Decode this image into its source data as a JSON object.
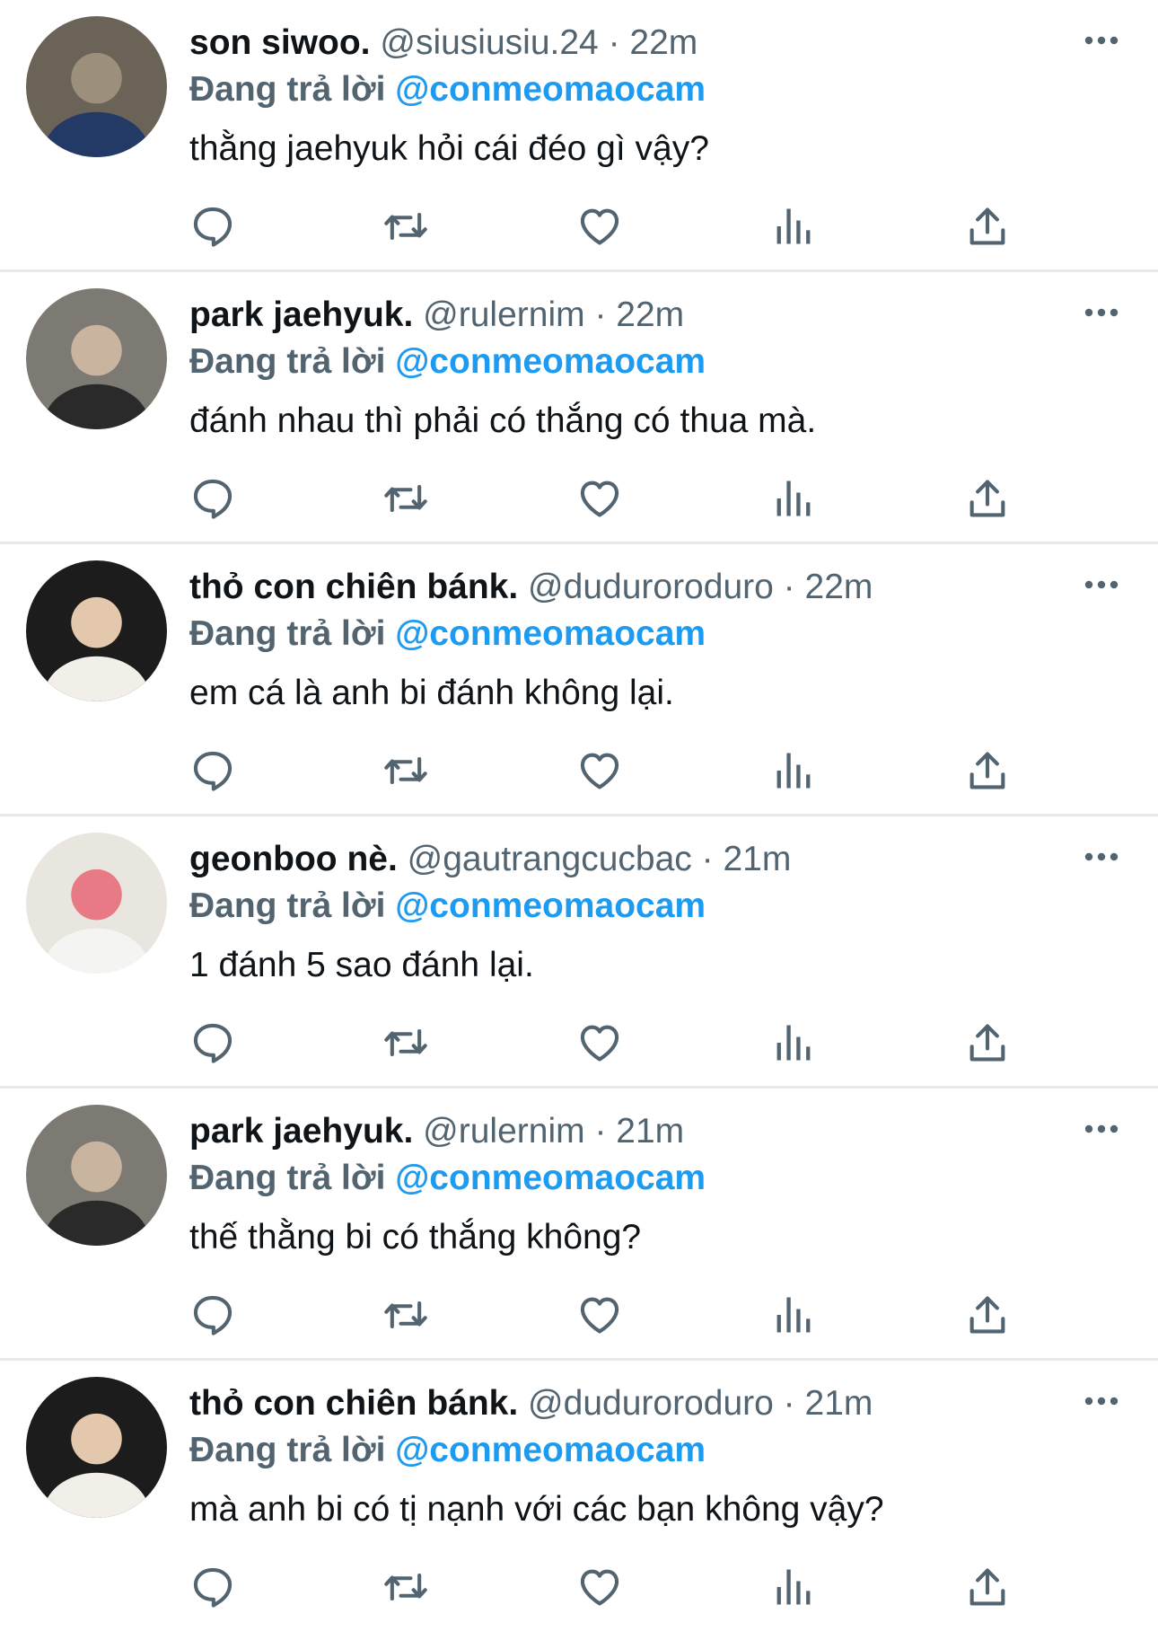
{
  "reply_prefix": "Đang trả lời",
  "tweets": [
    {
      "name": "son siwoo.",
      "handle": "@siusiusiu.24",
      "separator": "·",
      "time": "22m",
      "reply_to": "@conmeomaocam",
      "text": "thằng jaehyuk hỏi cái đéo gì vậy?",
      "avatar_colors": [
        "#6b6357",
        "#233a66",
        "#9c8f7c"
      ]
    },
    {
      "name": "park jaehyuk.",
      "handle": "@rulernim",
      "separator": "·",
      "time": "22m",
      "reply_to": "@conmeomaocam",
      "text": "đánh nhau thì phải có thắng có thua mà.",
      "avatar_colors": [
        "#7d7a74",
        "#2a2a2a",
        "#c9b4a0"
      ]
    },
    {
      "name": "thỏ con chiên bánk.",
      "handle": "@duduroroduro",
      "separator": "·",
      "time": "22m",
      "reply_to": "@conmeomaocam",
      "text": "em cá là anh bi đánh không lại.",
      "avatar_colors": [
        "#1c1c1c",
        "#f2efe9",
        "#e3c8ae"
      ]
    },
    {
      "name": "geonboo nè.",
      "handle": "@gautrangcucbac",
      "separator": "·",
      "time": "21m",
      "reply_to": "@conmeomaocam",
      "text": "1 đánh 5 sao đánh lại.",
      "avatar_colors": [
        "#e9e6e0",
        "#f4f4f2",
        "#e87a86"
      ]
    },
    {
      "name": "park jaehyuk.",
      "handle": "@rulernim",
      "separator": "·",
      "time": "21m",
      "reply_to": "@conmeomaocam",
      "text": "thế thằng bi có thắng không?",
      "avatar_colors": [
        "#7d7a74",
        "#2a2a2a",
        "#c9b4a0"
      ]
    },
    {
      "name": "thỏ con chiên bánk.",
      "handle": "@duduroroduro",
      "separator": "·",
      "time": "21m",
      "reply_to": "@conmeomaocam",
      "text": "mà anh bi có tị nạnh với các bạn không vậy?",
      "avatar_colors": [
        "#1c1c1c",
        "#f2efe9",
        "#e3c8ae"
      ]
    }
  ],
  "icons": {
    "more": "more-horizontal-icon",
    "reply": "reply-bubble-icon",
    "retweet": "retweet-icon",
    "like": "heart-icon",
    "views": "views-chart-icon",
    "share": "share-upload-icon"
  },
  "colors": {
    "text": "#0f1419",
    "secondary": "#536471",
    "mention": "#1d9bf0",
    "divider": "#e7e9eb"
  }
}
